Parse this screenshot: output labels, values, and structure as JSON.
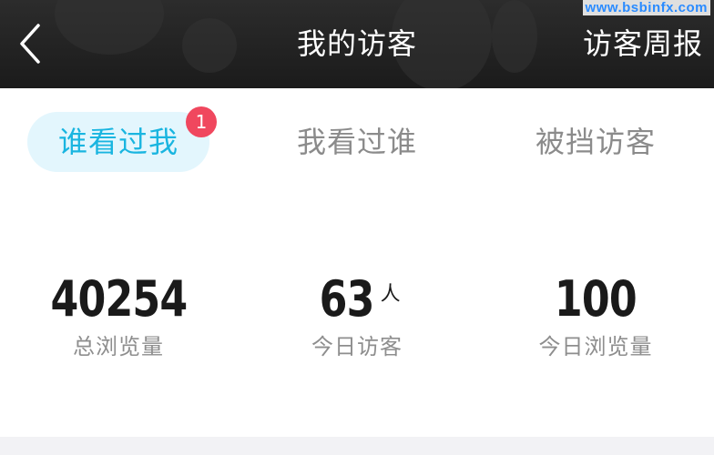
{
  "header": {
    "back_icon": "chevron-left-icon",
    "title": "我的访客",
    "weekly_report": "访客周报",
    "watermark": "www.bsbinfx.com"
  },
  "tabs": [
    {
      "label": "谁看过我",
      "active": true,
      "badge": "1"
    },
    {
      "label": "我看过谁",
      "active": false
    },
    {
      "label": "被挡访客",
      "active": false
    }
  ],
  "stats": [
    {
      "value": "40254",
      "unit": "",
      "label": "总浏览量"
    },
    {
      "value": "63",
      "unit": "人",
      "label": "今日访客"
    },
    {
      "value": "100",
      "unit": "",
      "label": "今日浏览量"
    }
  ],
  "colors": {
    "accent": "#19b5e0",
    "tab_active_bg": "#e3f6fd",
    "badge": "#f0475e",
    "header_bg": "#1f1f1f"
  }
}
